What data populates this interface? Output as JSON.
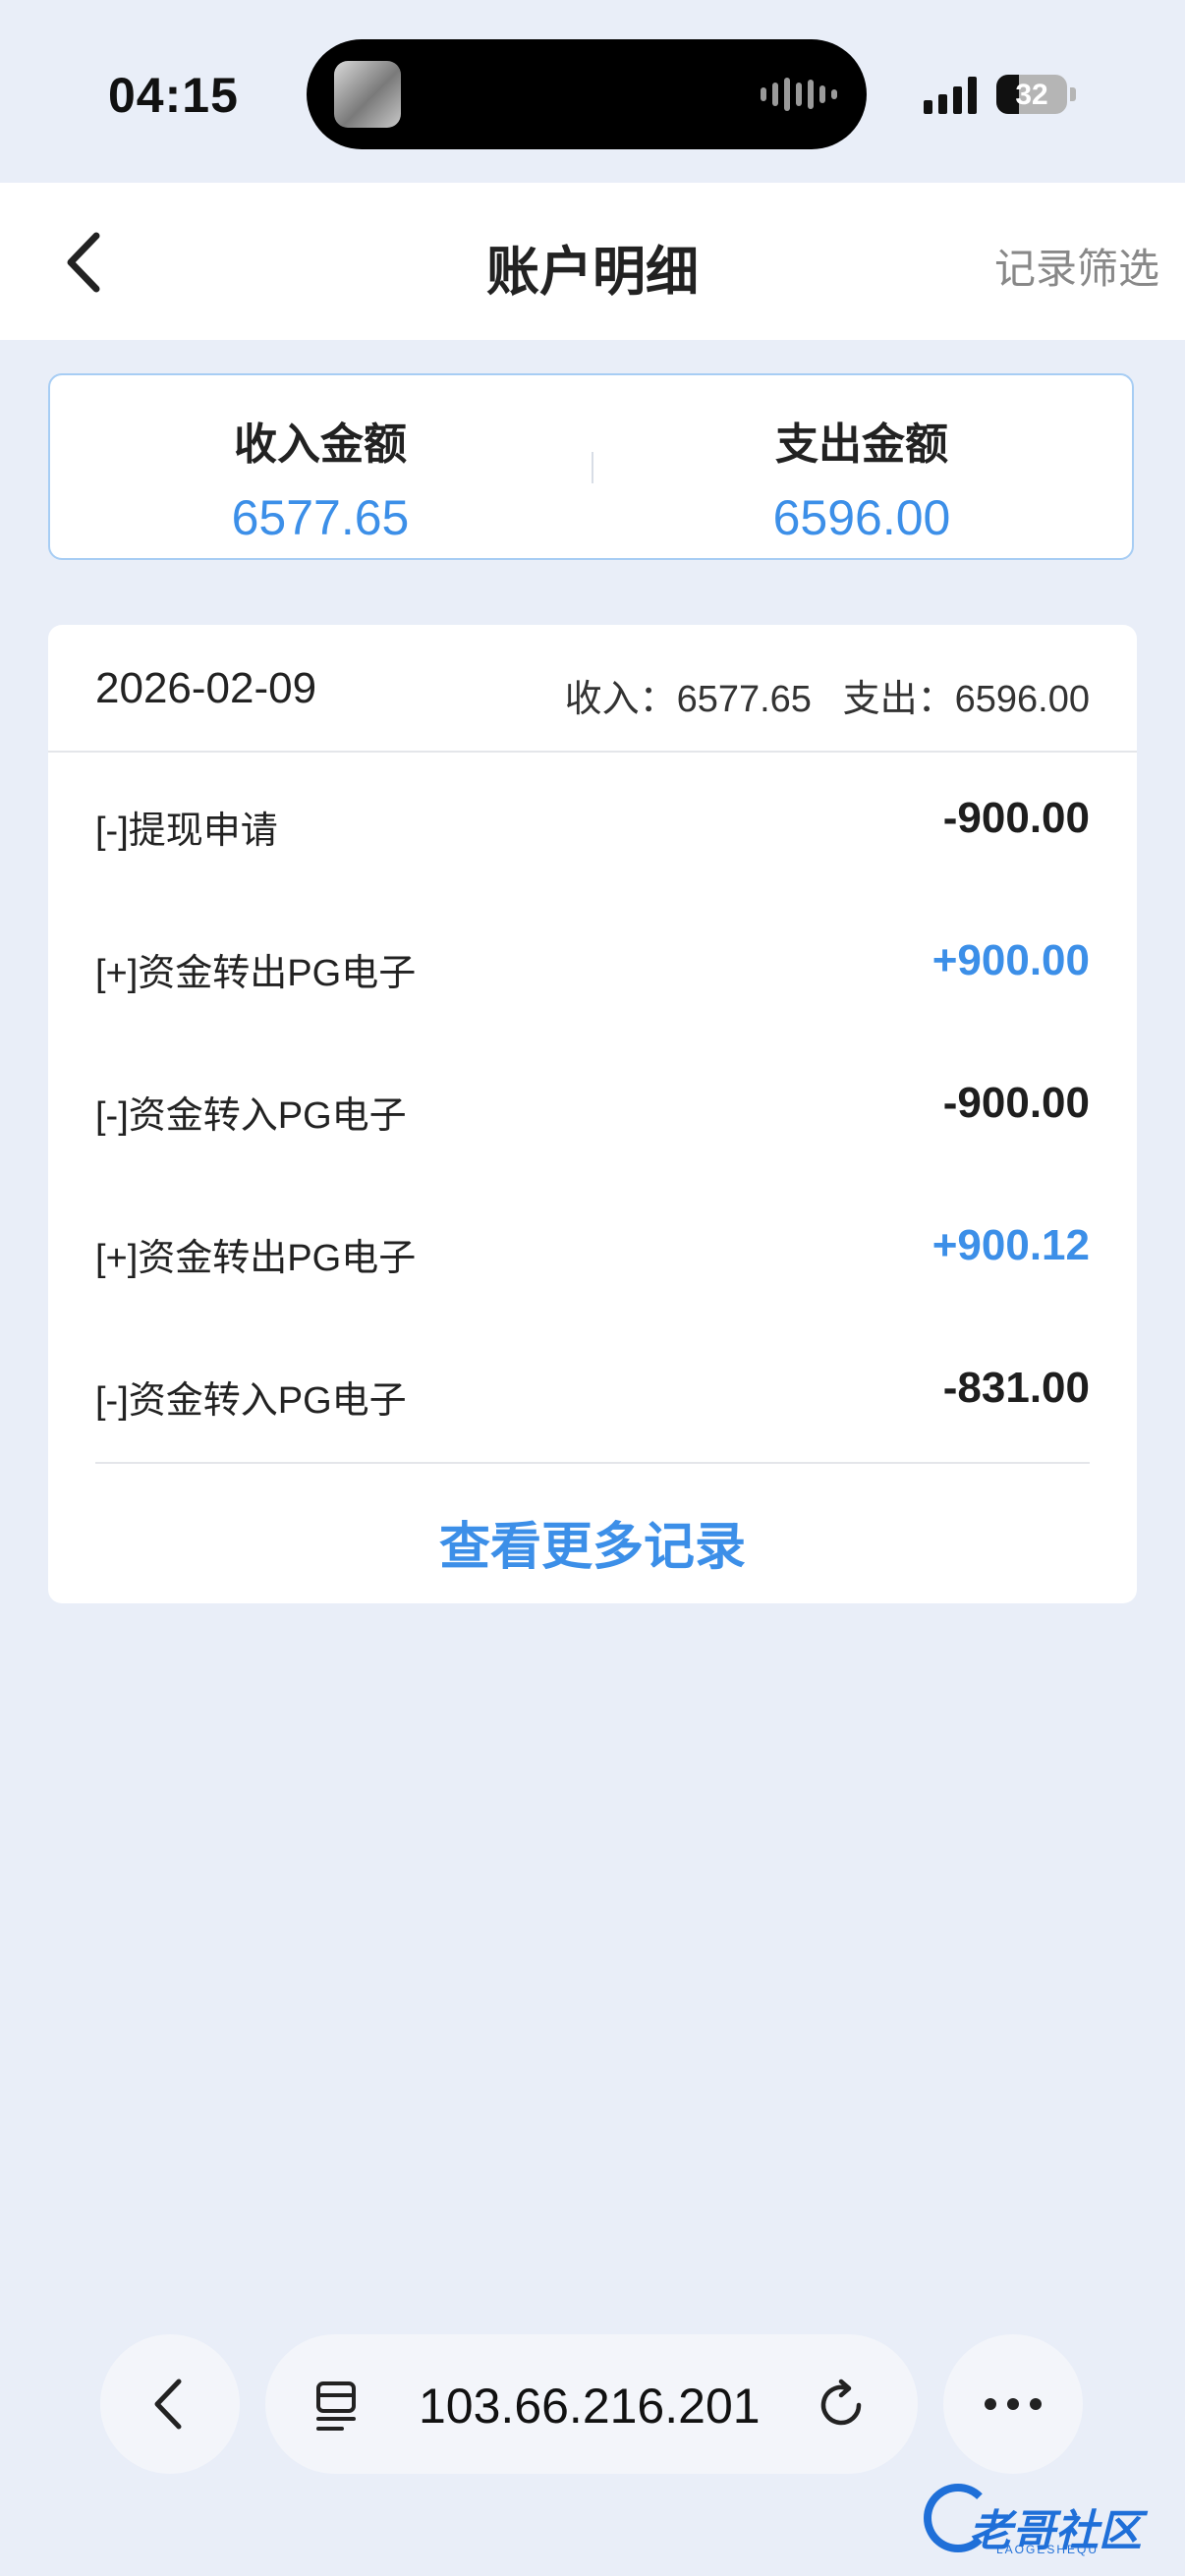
{
  "status": {
    "time": "04:15",
    "battery": "32",
    "battery_level": 0.32
  },
  "header": {
    "title": "账户明细",
    "filter_label": "记录筛选"
  },
  "summary": {
    "income_label": "收入金额",
    "income_value": "6577.65",
    "expense_label": "支出金额",
    "expense_value": "6596.00"
  },
  "detail": {
    "date": "2026-02-09",
    "income_text": "收入：6577.65",
    "expense_text": "支出：6596.00",
    "rows": [
      {
        "label": "[-]提现申请",
        "amount": "-900.00",
        "type": "neg"
      },
      {
        "label": "[+]资金转出PG电子",
        "amount": "+900.00",
        "type": "pos"
      },
      {
        "label": "[-]资金转入PG电子",
        "amount": "-900.00",
        "type": "neg"
      },
      {
        "label": "[+]资金转出PG电子",
        "amount": "+900.12",
        "type": "pos"
      },
      {
        "label": "[-]资金转入PG电子",
        "amount": "-831.00",
        "type": "neg"
      }
    ],
    "more_label": "查看更多记录"
  },
  "browser": {
    "url": "103.66.216.201",
    "icons": [
      "back-icon",
      "tabs-icon",
      "reload-icon",
      "more-icon"
    ]
  },
  "watermark": {
    "text": "老哥社区",
    "sub": "LAOGESHEQU"
  },
  "colors": {
    "accent": "#3c8fe8",
    "background": "#e9eef8",
    "card_border": "#a7cdf4"
  }
}
